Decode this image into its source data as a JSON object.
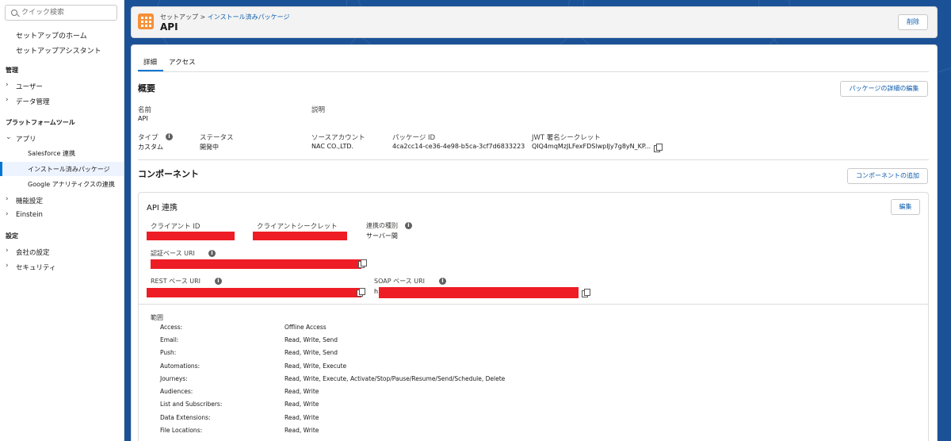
{
  "sidebar": {
    "search_placeholder": "クイック検索",
    "home": "セットアップのホーム",
    "assistant": "セットアップアシスタント",
    "admin_head": "管理",
    "users": "ユーザー",
    "data_mgmt": "データ管理",
    "platform_head": "プラットフォームツール",
    "apps": "アプリ",
    "sf_connect": "Salesforce 連携",
    "installed_pkgs": "インストール済みパッケージ",
    "google_analytics": "Google アナリティクスの連携",
    "feature_settings": "機能設定",
    "einstein": "Einstein",
    "settings_head": "設定",
    "company_settings": "会社の設定",
    "security": "セキュリティ"
  },
  "header": {
    "breadcrumb_root": "セットアップ",
    "breadcrumb_sep": ">",
    "breadcrumb_link": "インストール済みパッケージ",
    "title": "API",
    "delete_label": "削除"
  },
  "tabs": {
    "details": "詳細",
    "access": "アクセス"
  },
  "overview": {
    "title": "概要",
    "edit_button": "パッケージの詳細の編集",
    "name_label": "名前",
    "name_value": "API",
    "desc_label": "説明",
    "type_label": "タイプ",
    "type_value": "カスタム",
    "status_label": "ステータス",
    "status_value": "開発中",
    "source_label": "ソースアカウント",
    "source_value": "NAC CO.,LTD.",
    "pkgid_label": "パッケージ ID",
    "pkgid_value": "4ca2cc14-ce36-4e98-b5ca-3cf7d6833223",
    "jwt_label": "JWT 署名シークレット",
    "jwt_value": "QIQ4mqMzJLFexFDSlwpIJy7g8yN_KP..."
  },
  "components": {
    "title": "コンポーネント",
    "add_button": "コンポーネントの追加"
  },
  "api_card": {
    "title": "API 連携",
    "edit_button": "編集",
    "client_id_label": "クライアント ID",
    "client_secret_label": "クライアントシークレット",
    "integration_type_label": "連携の種別",
    "integration_type_value": "サーバー間",
    "auth_uri_label": "認証ベース URI",
    "rest_uri_label": "REST ベース URI",
    "soap_uri_label": "SOAP ベース URI",
    "soap_prefix": "h",
    "scope_title": "範囲",
    "scopes": [
      {
        "k": "Access:",
        "v": "Offline Access"
      },
      {
        "k": "Email:",
        "v": "Read, Write, Send"
      },
      {
        "k": "Push:",
        "v": "Read, Write, Send"
      },
      {
        "k": "Automations:",
        "v": "Read, Write, Execute"
      },
      {
        "k": "Journeys:",
        "v": "Read, Write, Execute, Activate/Stop/Pause/Resume/Send/Schedule, Delete"
      },
      {
        "k": "Audiences:",
        "v": "Read, Write"
      },
      {
        "k": "List and Subscribers:",
        "v": "Read, Write"
      },
      {
        "k": "Data Extensions:",
        "v": "Read, Write"
      },
      {
        "k": "File Locations:",
        "v": "Read, Write"
      }
    ]
  },
  "colors": {
    "brand_blue": "#0176d3",
    "link_blue": "#0b5cab",
    "app_icon": "#f59038",
    "redaction": "#ee1c25",
    "background": "#1b5297"
  }
}
